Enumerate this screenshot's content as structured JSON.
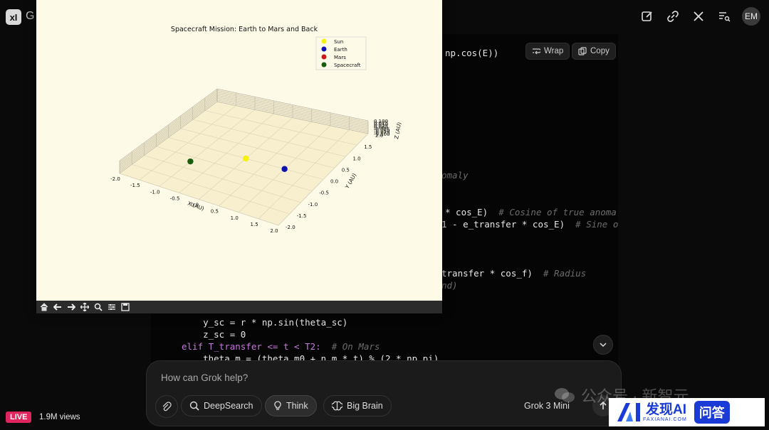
{
  "app": {
    "logo_text": "xI",
    "title_partial": "G"
  },
  "header": {
    "icons": [
      "edit-icon",
      "link-icon",
      "x-logo-icon",
      "search-list-icon"
    ],
    "avatar_initials": "EM"
  },
  "code_toolbar": {
    "wrap_label": "Wrap",
    "copy_label": "Copy"
  },
  "code_lines": [
    {
      "text": "np.cos(E))",
      "comment": ""
    },
    {
      "text": "",
      "comment": "omaly"
    },
    {
      "text": "* cos_E)  ",
      "comment": "# Cosine of true anomal"
    },
    {
      "text": "1 - e_transfer * cos_E)  ",
      "comment": "# Sine of"
    },
    {
      "text": "transfer * cos_f)  ",
      "comment": "# Radius"
    },
    {
      "text": "",
      "comment": "nd)"
    },
    {
      "text": "    y_sc = r * np.sin(theta_sc)",
      "comment": ""
    },
    {
      "text": "    z_sc = 0",
      "comment": ""
    },
    {
      "text": "elif T_transfer <= t < T2:  ",
      "comment": "# On Mars"
    },
    {
      "text": "    theta_m = (theta_m0 + n_m * t) % (2 * np.pi)",
      "comment": ""
    }
  ],
  "plot": {
    "chart_data": {
      "type": "scatter",
      "title": "Spacecraft Mission: Earth to Mars and Back",
      "xlabel": "X (AU)",
      "ylabel": "Y (AU)",
      "zlabel": "Z (AU)",
      "xlim": [
        -2.0,
        2.0
      ],
      "ylim": [
        -2.0,
        2.0
      ],
      "x_ticks": [
        "-2.0",
        "-1.5",
        "-1.0",
        "-0.5",
        "0.0",
        "0.5",
        "1.0",
        "1.5",
        "2.0"
      ],
      "y_ticks": [
        "-2.0",
        "-1.5",
        "-1.0",
        "-0.5",
        "0.0",
        "0.5",
        "1.0",
        "1.5",
        "2.0"
      ],
      "z_ticks": [
        "0.100",
        "0.075",
        "0.050",
        "0.025",
        "0.000",
        "-0.025",
        "-0.050",
        "-0.075",
        "-0.100"
      ],
      "grid": true,
      "legend_placement": "top-right",
      "series": [
        {
          "name": "Sun",
          "color": "#f4f20a",
          "points": [
            {
              "x": 0.0,
              "y": 0.0,
              "z": 0.0
            }
          ]
        },
        {
          "name": "Earth",
          "color": "#1010b0",
          "points": [
            {
              "x": 1.0,
              "y": 0.0,
              "z": 0.0
            }
          ]
        },
        {
          "name": "Mars",
          "color": "#c81818",
          "points": []
        },
        {
          "name": "Spacecraft",
          "color": "#1a5c10",
          "points": [
            {
              "x": -1.0,
              "y": -0.7,
              "z": 0.0
            }
          ]
        }
      ]
    },
    "toolbar_icons": [
      "home-icon",
      "back-icon",
      "forward-icon",
      "pan-icon",
      "zoom-icon",
      "configure-icon",
      "save-icon"
    ]
  },
  "composer": {
    "placeholder": "How can Grok help?",
    "deepsearch_label": "DeepSearch",
    "think_label": "Think",
    "bigbrain_label": "Big Brain",
    "model_label": "Grok 3 Mini"
  },
  "stream": {
    "live_label": "LIVE",
    "views": "1.9M views"
  },
  "watermark": {
    "text": "公众号 · 新智元"
  },
  "badge": {
    "title": "发现AI",
    "subtitle": "FAXIANAI.COM",
    "qa": "问答"
  }
}
